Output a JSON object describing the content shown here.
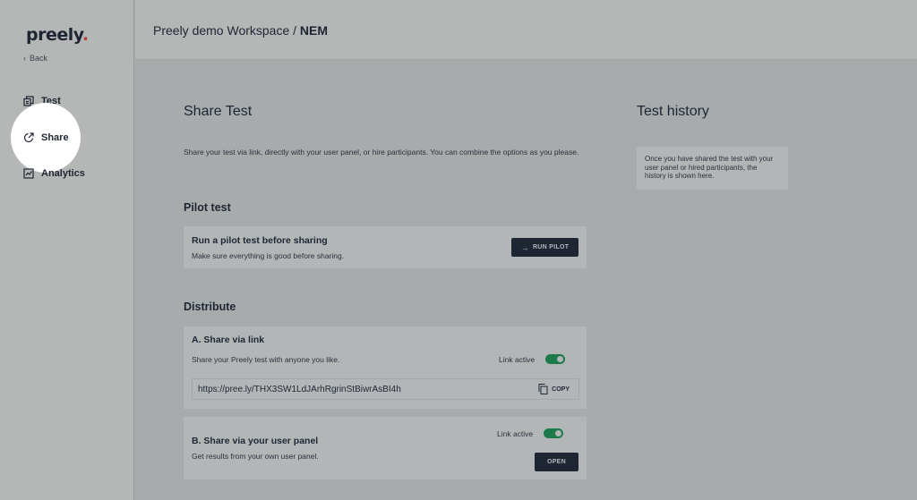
{
  "sidebar": {
    "logo": "preely",
    "logo_dot": ".",
    "back_label": "Back",
    "items": [
      {
        "label": "Test",
        "icon": "copy-icon"
      },
      {
        "label": "Share",
        "icon": "share-icon"
      },
      {
        "label": "Analytics",
        "icon": "chart-icon"
      }
    ]
  },
  "header": {
    "workspace": "Preely demo Workspace /",
    "project": "NEM"
  },
  "main": {
    "title": "Share Test",
    "description": "Share your test via link, directly with your user panel, or hire participants. You can combine the options as you please.",
    "pilot": {
      "section_title": "Pilot test",
      "card_title": "Run a pilot test before sharing",
      "card_sub": "Make sure everything is good before sharing.",
      "button": "RUN PILOT"
    },
    "distribute": {
      "section_title": "Distribute",
      "link": {
        "title": "A. Share via link",
        "sub": "Share your Preely test with anyone you like.",
        "toggle_label": "Link active",
        "url": "https://pree.ly/THX3SW1LdJArhRgrinStBiwrAsBI4h",
        "copy_label": "COPY"
      },
      "panel": {
        "title": "B. Share via your user panel",
        "sub": "Get results from your own user panel.",
        "toggle_label": "Link active",
        "button": "OPEN"
      }
    }
  },
  "history": {
    "title": "Test history",
    "text": "Once you have shared the test with your user panel or hired participants, the history is shown here."
  },
  "colors": {
    "accent_dark": "#1e2634",
    "toggle_on": "#1d7a4a",
    "logo_dot": "#b3413b"
  }
}
